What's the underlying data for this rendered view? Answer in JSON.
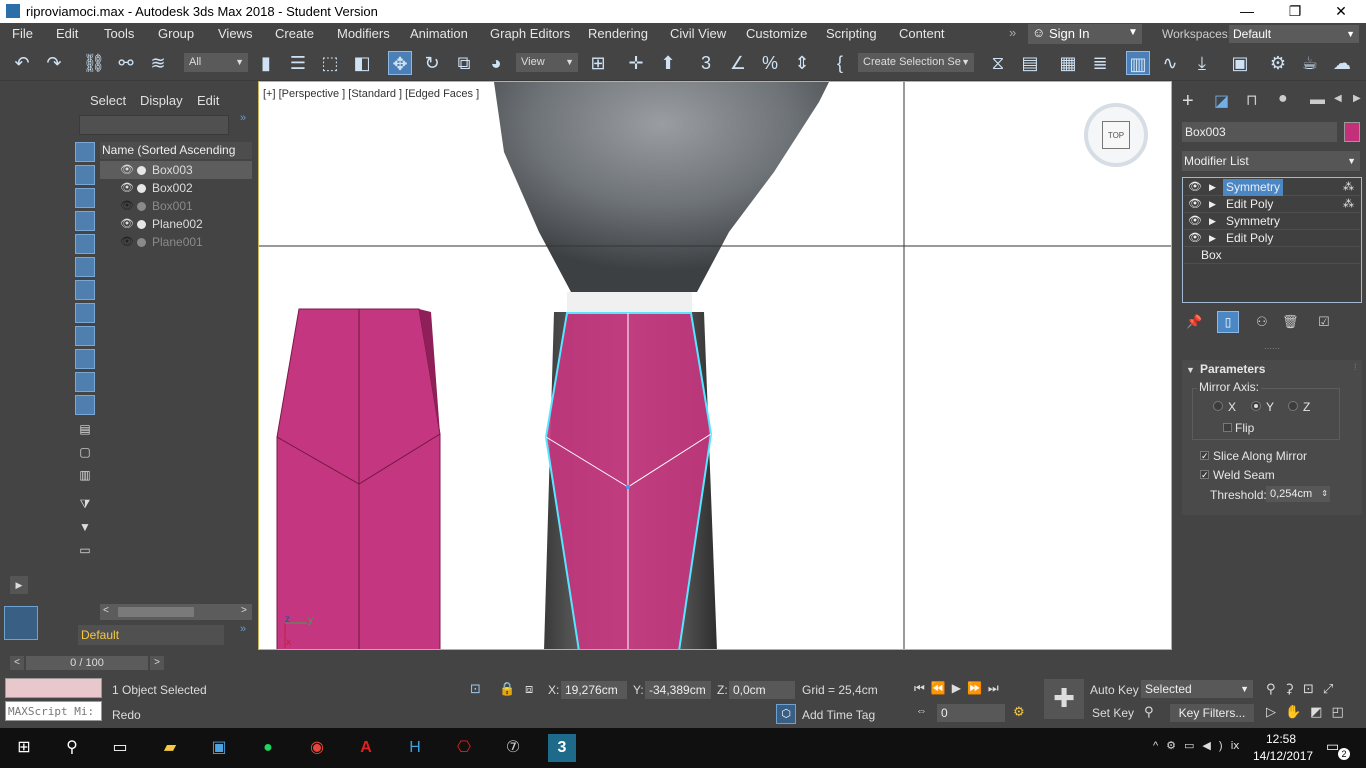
{
  "window": {
    "title": "riproviamoci.max - Autodesk 3ds Max 2018 - Student Version",
    "minimize": "—",
    "restore": "❐",
    "close": "✕"
  },
  "menu": [
    "File",
    "Edit",
    "Tools",
    "Group",
    "Views",
    "Create",
    "Modifiers",
    "Animation",
    "Graph Editors",
    "Rendering",
    "Civil View",
    "Customize",
    "Scripting",
    "Content"
  ],
  "signin": {
    "label": "Sign In"
  },
  "workspaces": {
    "label": "Workspaces:",
    "value": "Default"
  },
  "toolbar": {
    "filter_select": "All",
    "ref_coord_select": "View",
    "selection_set": "Create Selection Se"
  },
  "explorer": {
    "tabs": [
      "Select",
      "Display",
      "Edit"
    ],
    "header": "Name (Sorted Ascending Age)",
    "rows": [
      {
        "name": "Box003",
        "visible": true,
        "selected": true
      },
      {
        "name": "Box002",
        "visible": true,
        "selected": false
      },
      {
        "name": "Box001",
        "visible": false,
        "selected": false
      },
      {
        "name": "Plane002",
        "visible": true,
        "selected": false
      },
      {
        "name": "Plane001",
        "visible": false,
        "selected": false
      }
    ],
    "layer": "Default"
  },
  "viewport": {
    "label": "[+] [Perspective ] [Standard ] [Edged Faces ]",
    "viewcube": "TOP",
    "axis_z": "z",
    "axis_y": "y",
    "axis_x": "x"
  },
  "command_panel": {
    "object_name": "Box003",
    "object_color": "#c2307a",
    "modifier_list": "Modifier List",
    "stack": [
      {
        "label": "Symmetry",
        "selected": true
      },
      {
        "label": "Edit Poly",
        "selected": false
      },
      {
        "label": "Symmetry",
        "selected": false
      },
      {
        "label": "Edit Poly",
        "selected": false
      }
    ],
    "base": "Box",
    "parameters": {
      "title": "Parameters",
      "mirror_axis": "Mirror Axis:",
      "axes": [
        "X",
        "Y",
        "Z"
      ],
      "active_axis": "Y",
      "flip": "Flip",
      "slice": "Slice Along Mirror",
      "weld": "Weld Seam",
      "threshold_label": "Threshold:",
      "threshold_value": "0,254cm"
    }
  },
  "timeslider": {
    "frame": "0 / 100",
    "prev": "<",
    "next": ">"
  },
  "status": {
    "selection": "1 Object Selected",
    "prompt": "Redo",
    "maxscript": "MAXScript Mi:",
    "x_label": "X:",
    "x_value": "19,276cm",
    "y_label": "Y:",
    "y_value": "-34,389cm",
    "z_label": "Z:",
    "z_value": "0,0cm",
    "grid": "Grid = 25,4cm",
    "add_time_tag": "Add Time Tag",
    "auto_key": "Auto Key",
    "set_key": "Set Key",
    "key_mode": "Selected",
    "key_filters": "Key Filters...",
    "frame_field": "0"
  },
  "taskbar": {
    "time": "12:58",
    "date": "14/12/2017",
    "notifications": "2"
  },
  "colors": {
    "accent": "#4b86c5",
    "object_pink": "#c2307a",
    "viewport_border": "#c9b45a"
  }
}
